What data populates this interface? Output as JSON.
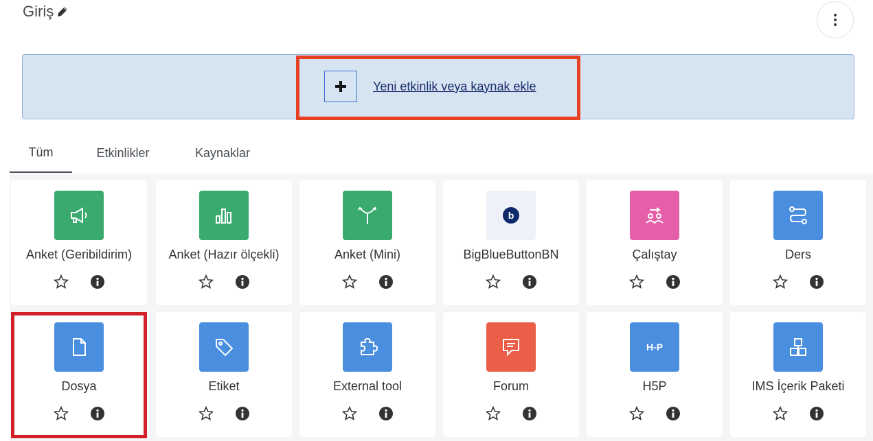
{
  "section": {
    "title": "Giriş"
  },
  "add_activity": {
    "label": "Yeni etkinlik veya kaynak ekle"
  },
  "tabs": [
    {
      "label": "Tüm"
    },
    {
      "label": "Etkinlikler"
    },
    {
      "label": "Kaynaklar"
    }
  ],
  "modules": [
    {
      "label": "Anket (Geribildirim)",
      "icon": "megaphone-icon",
      "color": "#3aaa6f"
    },
    {
      "label": "Anket (Hazır ölçekli)",
      "icon": "bar-chart-icon",
      "color": "#3aaa6f"
    },
    {
      "label": "Anket (Mini)",
      "icon": "signpost-icon",
      "color": "#3aaa6f"
    },
    {
      "label": "BigBlueButtonBN",
      "icon": "bigbluebutton-icon",
      "color": "#eef2f8"
    },
    {
      "label": "Çalıştay",
      "icon": "workshop-icon",
      "color": "#e55fa8"
    },
    {
      "label": "Ders",
      "icon": "lesson-icon",
      "color": "#4a8ee0"
    },
    {
      "label": "Dosya",
      "icon": "file-icon",
      "color": "#4a8ee0"
    },
    {
      "label": "Etiket",
      "icon": "tag-icon",
      "color": "#4a8ee0"
    },
    {
      "label": "External tool",
      "icon": "puzzle-icon",
      "color": "#4a8ee0"
    },
    {
      "label": "Forum",
      "icon": "forum-icon",
      "color": "#eb5e48"
    },
    {
      "label": "H5P",
      "icon": "h5p-icon",
      "color": "#4a8ee0",
      "icon_text": "H-P"
    },
    {
      "label": "IMS İçerik Paketi",
      "icon": "package-icon",
      "color": "#4a8ee0"
    }
  ]
}
